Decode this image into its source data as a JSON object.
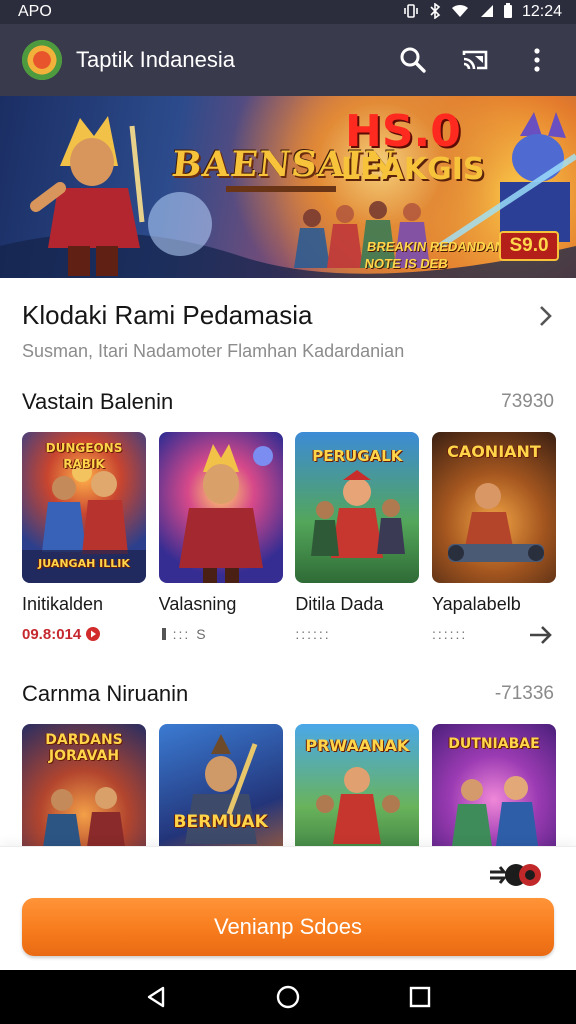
{
  "status_bar": {
    "carrier": "APO",
    "time": "12:24"
  },
  "app_bar": {
    "title": "Taptik Indanesia"
  },
  "banner": {
    "title": "BAENSAIN",
    "edition": "HS.0",
    "name": "LEAKGIS",
    "tagline_1": "BREAKIN REDANDAN",
    "tagline_2": "NOTE IS DEB",
    "price": "S9.0"
  },
  "featured": {
    "title": "Klodaki Rami Pedamasia",
    "subtitle": "Susman, Itari Nadamoter Flamhan Kadardanian"
  },
  "section_1": {
    "title": "Vastain Balenin",
    "count": "73930",
    "items": [
      {
        "name": "Initikalden",
        "meta": "09.8:014",
        "art": "DUNGEONS RABIK",
        "art_bottom": "JUANGAH ILLIK"
      },
      {
        "name": "Valasning",
        "meta": "::: S",
        "art": "",
        "art_bottom": ""
      },
      {
        "name": "Ditila Dada",
        "meta": "::::::",
        "art": "PERUGALK",
        "art_bottom": ""
      },
      {
        "name": "Yapalabelb",
        "meta": "::::::",
        "art": "CAONIANT",
        "art_bottom": ""
      }
    ]
  },
  "section_2": {
    "title": "Carnma Niruanin",
    "count": "-71336",
    "items": [
      {
        "art": "DARDANS JORAVAH"
      },
      {
        "art": "BERMUAK"
      },
      {
        "art": "PRWAANAK"
      },
      {
        "art": "DUTNIABAE"
      }
    ]
  },
  "cta": {
    "label": "Venianp Sdoes"
  },
  "colors": {
    "app_bar": "#393a4c",
    "status_bar": "#2b2d3c",
    "accent": "#f77c1d",
    "nav_bar": "#000000"
  },
  "icons": {
    "app_bar": [
      "search-icon",
      "cast-icon",
      "more-vert-icon"
    ],
    "nav": [
      "back-icon",
      "home-icon",
      "recents-icon"
    ]
  }
}
